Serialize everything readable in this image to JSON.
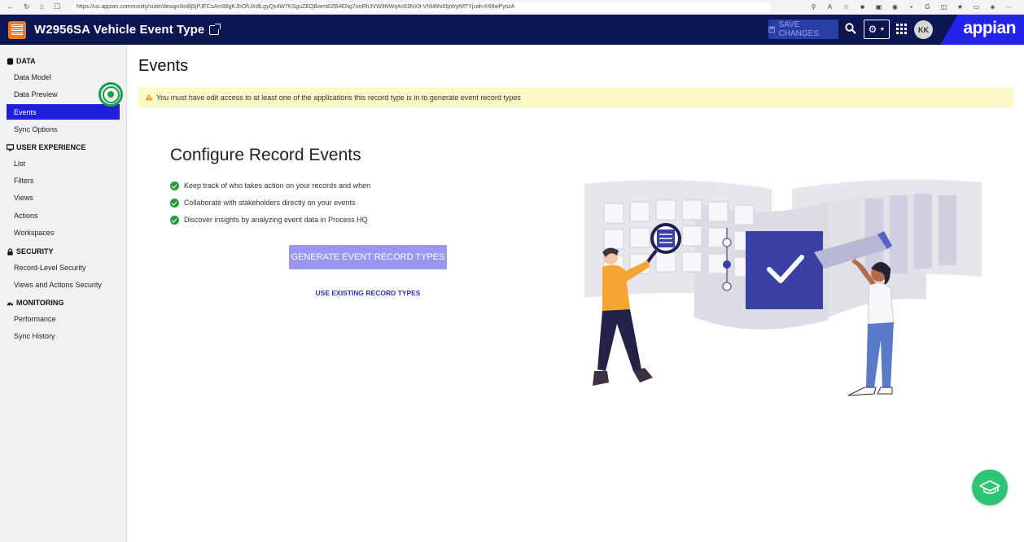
{
  "browser": {
    "url_prefix": "https://",
    "url_host": "us.appian.community",
    "url_path": "/suite/design/koBj5jPJFCsAm98gKJhOfUXdlLgyQs4W7KSguZEQBwmt02B4ENg7ooRh3VW9NWq4o93NX9-VhM8hi6fpWytMTYjvah-K68wPyszA"
  },
  "header": {
    "app_title": "W2956SA Vehicle Event Type",
    "save_label": "SAVE CHANGES",
    "avatar_initials": "KK",
    "brand": "appian",
    "colors": {
      "header_bg": "#0b1653",
      "brand_bg": "#2322f0",
      "logo_bg": "#f37720"
    }
  },
  "sidebar": {
    "sections": [
      {
        "title": "DATA",
        "icon": "database-icon",
        "items": [
          "Data Model",
          "Data Preview",
          "Events",
          "Sync Options"
        ]
      },
      {
        "title": "USER EXPERIENCE",
        "icon": "monitor-icon",
        "items": [
          "List",
          "Filters",
          "Views",
          "Actions",
          "Workspaces"
        ]
      },
      {
        "title": "SECURITY",
        "icon": "lock-icon",
        "items": [
          "Record-Level Security",
          "Views and Actions Security"
        ]
      },
      {
        "title": "MONITORING",
        "icon": "gauge-icon",
        "items": [
          "Performance",
          "Sync History"
        ]
      }
    ],
    "active_item": "Events",
    "active_color": "#1f20d8"
  },
  "main": {
    "page_title": "Events",
    "warning": "You must have edit access to at least one of the applications this record type is in to generate event record types",
    "configure_title": "Configure Record Events",
    "bullets": [
      "Keep track of who takes action on your records and when",
      "Collaborate with stakeholders directly on your events",
      "Discover insights by analyzing event data in Process HQ"
    ],
    "generate_button": "GENERATE EVENT RECORD TYPES",
    "use_existing_link": "USE EXISTING RECORD TYPES",
    "colors": {
      "warning_bg": "#fbf9c8",
      "generate_bg": "#9a97f0",
      "check": "#1f9d3a",
      "help_bg": "#2fc374"
    }
  }
}
